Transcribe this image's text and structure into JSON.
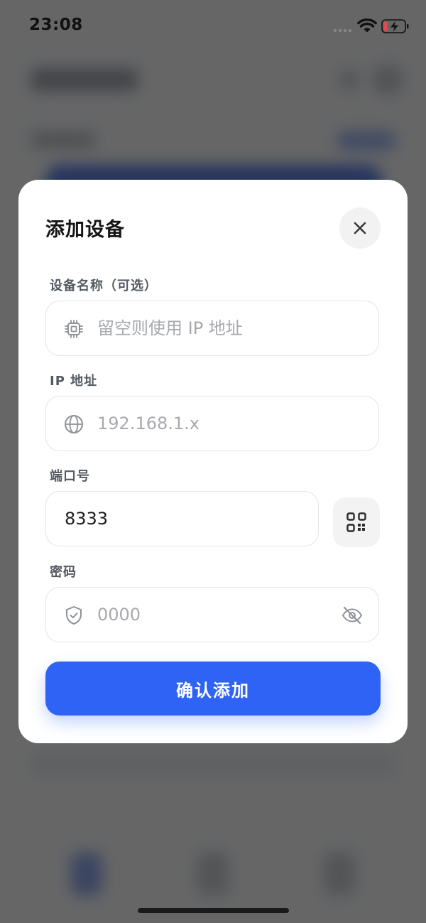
{
  "status_bar": {
    "time": "23:08"
  },
  "dialog": {
    "title": "添加设备",
    "fields": {
      "name": {
        "label": "设备名称（可选）",
        "value": "",
        "placeholder": "留空则使用 IP 地址",
        "icon": "chip-icon"
      },
      "ip": {
        "label": "IP 地址",
        "value": "",
        "placeholder": "192.168.1.x",
        "icon": "globe-icon"
      },
      "port": {
        "label": "端口号",
        "value": "8333",
        "placeholder": ""
      },
      "password": {
        "label": "密码",
        "value": "",
        "placeholder": "0000",
        "icon": "shield-icon"
      }
    },
    "confirm_label": "确认添加"
  },
  "colors": {
    "accent": "#2e63f5",
    "placeholder": "#a7a9ae",
    "label": "#555a62",
    "battery_low": "#e5484d"
  }
}
